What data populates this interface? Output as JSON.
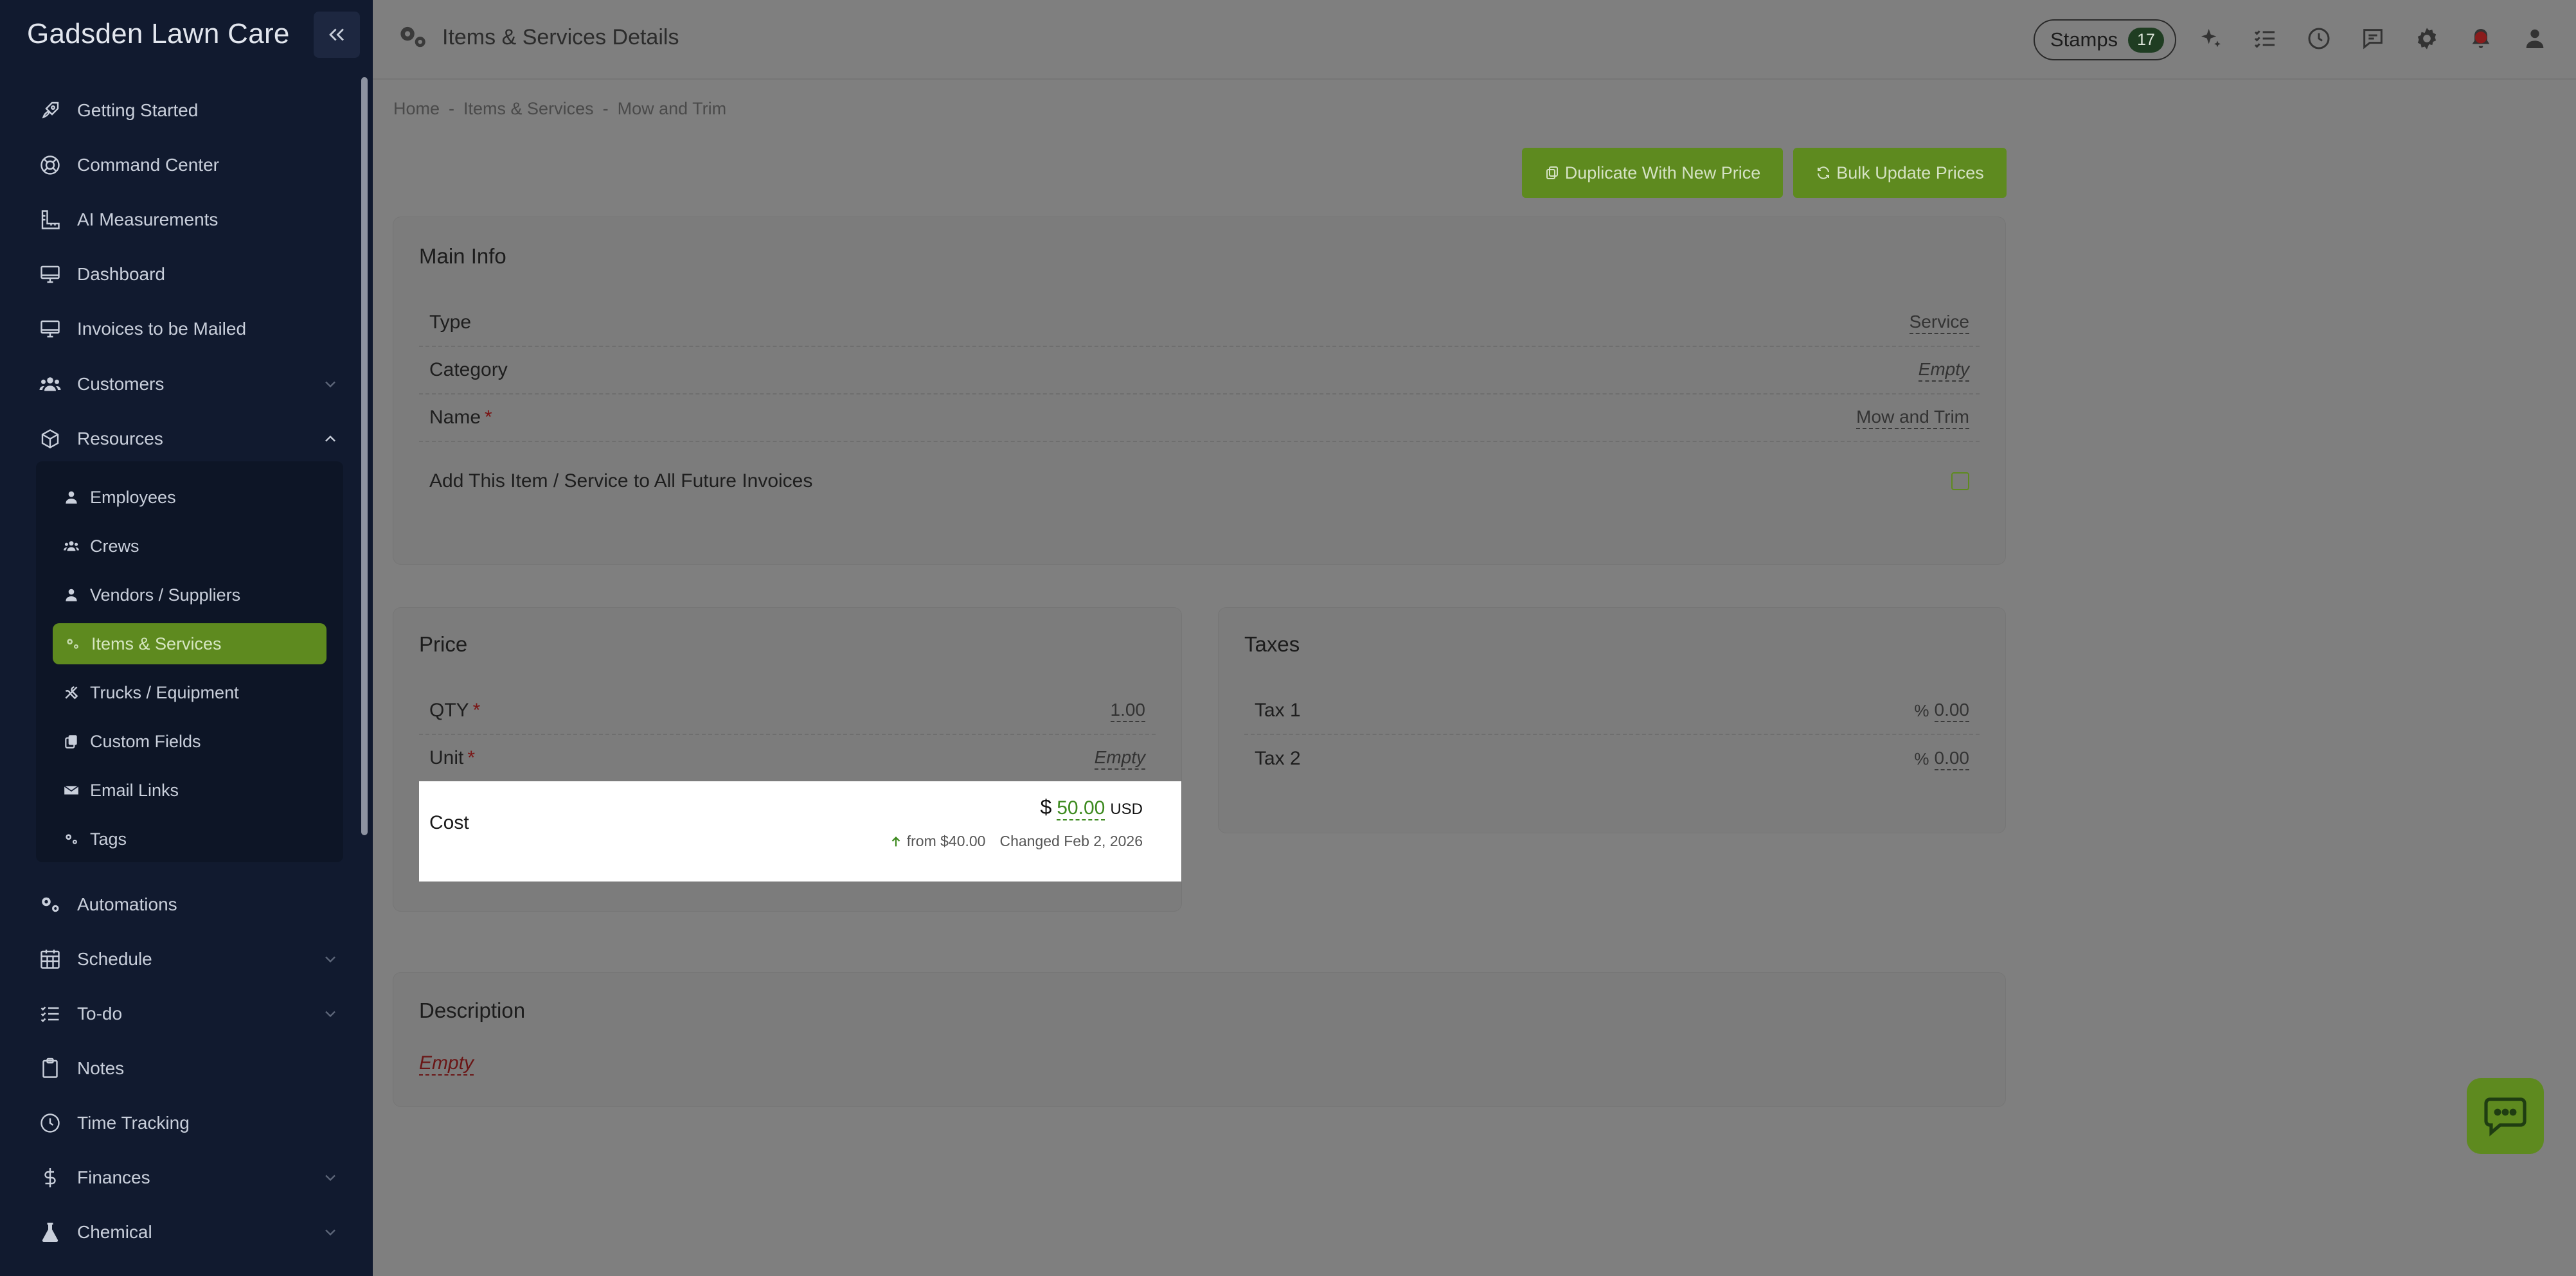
{
  "sidebar": {
    "brand": "Gadsden Lawn Care",
    "items": [
      {
        "label": "Getting Started",
        "icon": "rocket-icon"
      },
      {
        "label": "Command Center",
        "icon": "lifebuoy-icon"
      },
      {
        "label": "AI Measurements",
        "icon": "ruler-icon"
      },
      {
        "label": "Dashboard",
        "icon": "monitor-icon"
      },
      {
        "label": "Invoices to be Mailed",
        "icon": "monitor-icon"
      },
      {
        "label": "Customers",
        "icon": "users-icon"
      },
      {
        "label": "Resources",
        "icon": "cube-icon"
      },
      {
        "label": "Automations",
        "icon": "gears-icon"
      },
      {
        "label": "Schedule",
        "icon": "calendar-icon"
      },
      {
        "label": "To-do",
        "icon": "checklist-icon"
      },
      {
        "label": "Notes",
        "icon": "clipboard-icon"
      },
      {
        "label": "Time Tracking",
        "icon": "clock-icon"
      },
      {
        "label": "Finances",
        "icon": "dollar-icon"
      },
      {
        "label": "Chemical",
        "icon": "flask-icon"
      }
    ],
    "resources_sub": [
      {
        "label": "Employees",
        "icon": "user-icon"
      },
      {
        "label": "Crews",
        "icon": "users-icon"
      },
      {
        "label": "Vendors / Suppliers",
        "icon": "user-icon"
      },
      {
        "label": "Items & Services",
        "icon": "gears-icon"
      },
      {
        "label": "Trucks / Equipment",
        "icon": "tools-icon"
      },
      {
        "label": "Custom Fields",
        "icon": "copy-icon"
      },
      {
        "label": "Email Links",
        "icon": "envelope-icon"
      },
      {
        "label": "Tags",
        "icon": "gears-icon"
      }
    ]
  },
  "header": {
    "title": "Items & Services Details",
    "stamps_label": "Stamps",
    "stamps_count": "17"
  },
  "breadcrumb": [
    "Home",
    "-",
    "Items & Services",
    "-",
    "Mow and Trim"
  ],
  "actions": {
    "duplicate": "Duplicate With New Price",
    "bulk_update": "Bulk Update Prices"
  },
  "main_info": {
    "title": "Main Info",
    "type_label": "Type",
    "type_value": "Service",
    "category_label": "Category",
    "category_value": "Empty",
    "name_label": "Name",
    "name_value": "Mow and Trim",
    "future_label": "Add This Item / Service to All Future Invoices",
    "required_mark": "*"
  },
  "price": {
    "title": "Price",
    "qty_label": "QTY",
    "qty_value": "1.00",
    "unit_label": "Unit",
    "unit_value": "Empty",
    "cost_label": "Cost",
    "cost_symbol": "$",
    "cost_value": "50.00",
    "cost_currency": "USD",
    "cost_from": "from $40.00",
    "cost_changed": "Changed Feb 2, 2026"
  },
  "taxes": {
    "title": "Taxes",
    "tax1_label": "Tax 1",
    "tax1_value": "0.00",
    "tax2_label": "Tax 2",
    "tax2_value": "0.00",
    "percent": "%"
  },
  "description": {
    "title": "Description",
    "value": "Empty"
  },
  "colors": {
    "sidebar_bg": "#111a2f",
    "accent": "#5e8a1f",
    "overlay": "#7f7f7f"
  }
}
